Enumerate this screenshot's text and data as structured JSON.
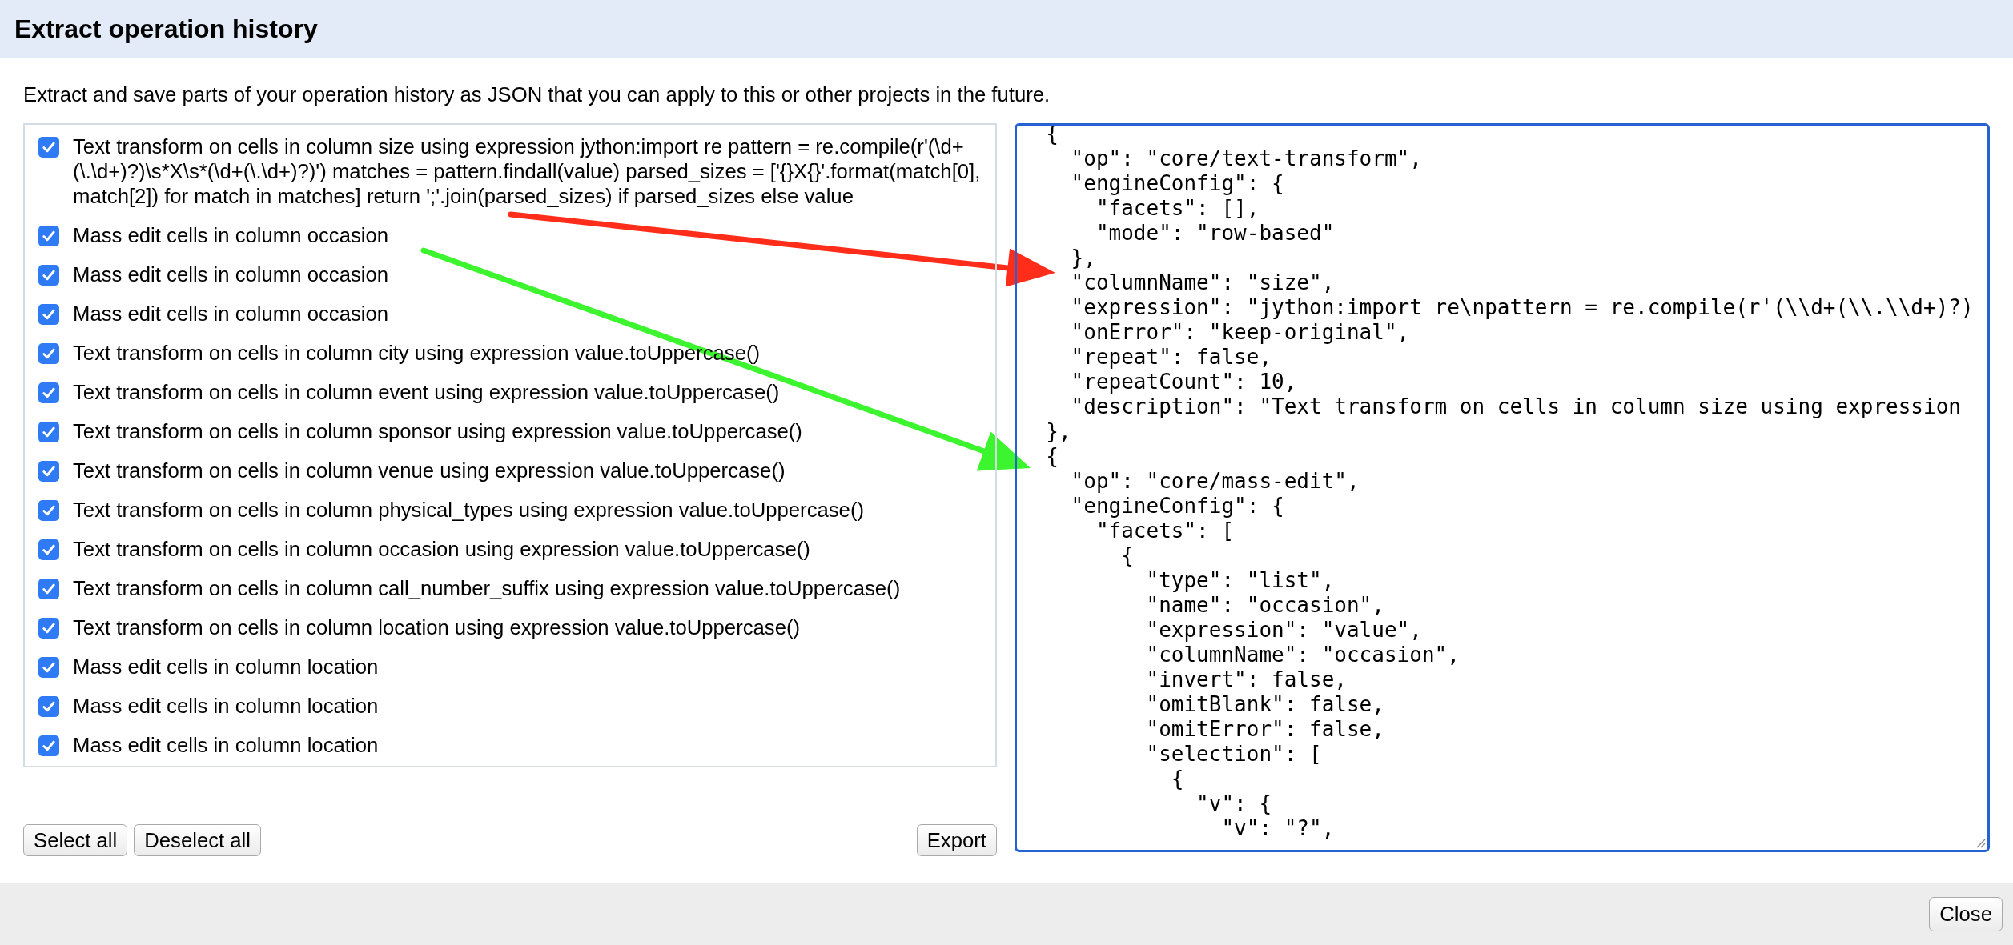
{
  "dialog": {
    "title": "Extract operation history"
  },
  "description": "Extract and save parts of your operation history as JSON that you can apply to this or other projects in the future.",
  "operations": [
    {
      "label": "Text transform on cells in column size using expression jython:import re pattern = re.compile(r'(\\d+(\\.\\d+)?)\\s*X\\s*(\\d+(\\.\\d+)?)') matches = pattern.findall(value) parsed_sizes = ['{}X{}'.format(match[0], match[2]) for match in matches] return ';'.join(parsed_sizes) if parsed_sizes else value",
      "checked": true
    },
    {
      "label": "Mass edit cells in column occasion",
      "checked": true
    },
    {
      "label": "Mass edit cells in column occasion",
      "checked": true
    },
    {
      "label": "Mass edit cells in column occasion",
      "checked": true
    },
    {
      "label": "Text transform on cells in column city using expression value.toUppercase()",
      "checked": true
    },
    {
      "label": "Text transform on cells in column event using expression value.toUppercase()",
      "checked": true
    },
    {
      "label": "Text transform on cells in column sponsor using expression value.toUppercase()",
      "checked": true
    },
    {
      "label": "Text transform on cells in column venue using expression value.toUppercase()",
      "checked": true
    },
    {
      "label": "Text transform on cells in column physical_types using expression value.toUppercase()",
      "checked": true
    },
    {
      "label": "Text transform on cells in column occasion using expression value.toUppercase()",
      "checked": true
    },
    {
      "label": "Text transform on cells in column call_number_suffix using expression value.toUppercase()",
      "checked": true
    },
    {
      "label": "Text transform on cells in column location using expression value.toUppercase()",
      "checked": true
    },
    {
      "label": "Mass edit cells in column location",
      "checked": true
    },
    {
      "label": "Mass edit cells in column location",
      "checked": true
    },
    {
      "label": "Mass edit cells in column location",
      "checked": true
    }
  ],
  "selection_buttons": [
    {
      "label": "Select all"
    },
    {
      "label": "Deselect all"
    }
  ],
  "export_button": {
    "label": "Export"
  },
  "export_json": {
    "lines": [
      "  {",
      "    \"op\": \"core/text-transform\",",
      "    \"engineConfig\": {",
      "      \"facets\": [],",
      "      \"mode\": \"row-based\"",
      "    },",
      "    \"columnName\": \"size\",",
      "    \"expression\": \"jython:import re\\npattern = re.compile(r'(\\\\d+(\\\\.\\\\d+)?)",
      "    \"onError\": \"keep-original\",",
      "    \"repeat\": false,",
      "    \"repeatCount\": 10,",
      "    \"description\": \"Text transform on cells in column size using expression",
      "  },",
      "  {",
      "    \"op\": \"core/mass-edit\",",
      "    \"engineConfig\": {",
      "      \"facets\": [",
      "        {",
      "          \"type\": \"list\",",
      "          \"name\": \"occasion\",",
      "          \"expression\": \"value\",",
      "          \"columnName\": \"occasion\",",
      "          \"invert\": false,",
      "          \"omitBlank\": false,",
      "          \"omitError\": false,",
      "          \"selection\": [",
      "            {",
      "              \"v\": {",
      "                \"v\": \"?\","
    ]
  },
  "footer": {
    "close_button": {
      "label": "Close"
    }
  }
}
